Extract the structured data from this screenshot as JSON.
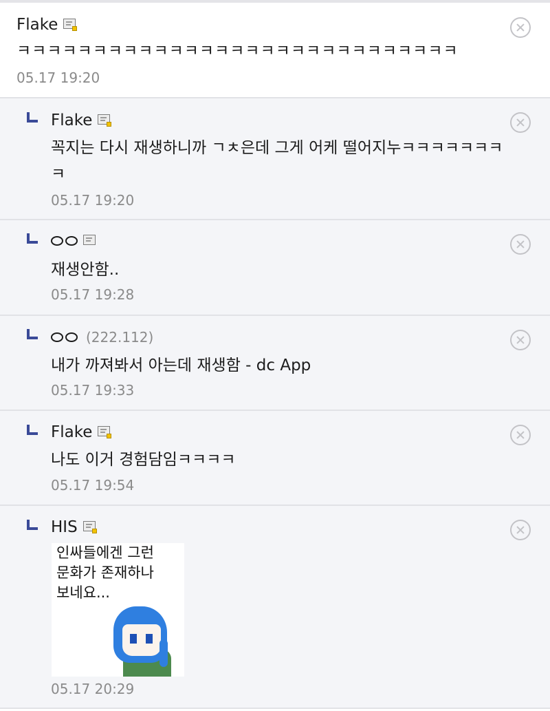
{
  "comments": [
    {
      "nick": "Flake",
      "text": "ㅋㅋㅋㅋㅋㅋㅋㅋㅋㅋㅋㅋㅋㅋㅋㅋㅋㅋㅋㅋㅋㅋㅋㅋㅋㅋㅋㅋㅋ",
      "date": "05.17 19:20"
    },
    {
      "nick": "Flake",
      "text_line1": "꼭지는 다시 재생하니까 ㄱㅊ은데 그게 어케 떨어지누ㅋㅋㅋㅋㅋㅋㅋ",
      "text_line2": "ㅋ",
      "date": "05.17 19:20"
    },
    {
      "nick": "ㅇㅇ",
      "text": "재생안함..",
      "date": "05.17 19:28"
    },
    {
      "nick": "ㅇㅇ",
      "ip": "(222.112)",
      "text": "내가 까져봐서 아는데 재생함 - dc App",
      "date": "05.17 19:33"
    },
    {
      "nick": "Flake",
      "text": "나도 이거 경험담임ㅋㅋㅋㅋ",
      "date": "05.17 19:54"
    },
    {
      "nick": "HIS",
      "dccon_lines": [
        "인싸들에겐 그런",
        "문화가 존재하나",
        "보네요..."
      ],
      "date": "05.17 20:29"
    }
  ],
  "icons": {
    "reply": "reply-arrow-icon",
    "gallog": "gallog-badge-icon",
    "delete": "delete-x-circle-icon"
  },
  "colors": {
    "reply_arrow": "#3a4a98",
    "reply_bg": "#f4f5f8",
    "date": "#8a8a8a",
    "delete_icon": "#c3c3c7"
  }
}
